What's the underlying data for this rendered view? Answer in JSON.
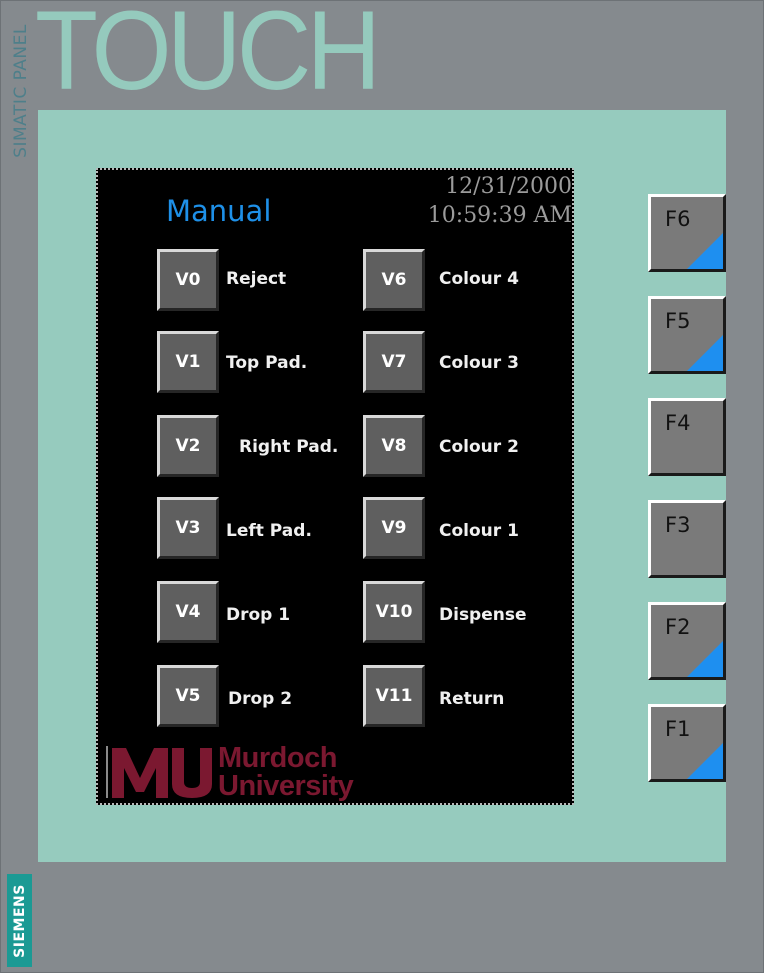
{
  "branding": {
    "panel_label": "SIMATIC PANEL",
    "product": "TOUCH",
    "manufacturer": "SIEMENS"
  },
  "screen": {
    "title": "Manual",
    "date": "12/31/2000",
    "time": "10:59:39 AM",
    "logo": {
      "line1": "Murdoch",
      "line2": "University",
      "color": "#7b1830"
    }
  },
  "valves": [
    {
      "id": "V0",
      "label": "Reject"
    },
    {
      "id": "V1",
      "label": "Top Pad."
    },
    {
      "id": "V2",
      "label": "Right Pad."
    },
    {
      "id": "V3",
      "label": "Left Pad."
    },
    {
      "id": "V4",
      "label": "Drop 1"
    },
    {
      "id": "V5",
      "label": "Drop 2"
    },
    {
      "id": "V6",
      "label": "Colour 4"
    },
    {
      "id": "V7",
      "label": "Colour 3"
    },
    {
      "id": "V8",
      "label": "Colour 2"
    },
    {
      "id": "V9",
      "label": "Colour 1"
    },
    {
      "id": "V10",
      "label": "Dispense"
    },
    {
      "id": "V11",
      "label": "Return"
    }
  ],
  "function_keys": [
    {
      "label": "F6",
      "marked": true
    },
    {
      "label": "F5",
      "marked": true
    },
    {
      "label": "F4",
      "marked": false
    },
    {
      "label": "F3",
      "marked": false
    },
    {
      "label": "F2",
      "marked": true
    },
    {
      "label": "F1",
      "marked": true
    }
  ],
  "colors": {
    "bezel": "#96cbbe",
    "housing": "#858a8e",
    "title": "#1e90e8",
    "fkey_corner": "#1e8ff0",
    "siemens_badge": "#1b9a94"
  }
}
